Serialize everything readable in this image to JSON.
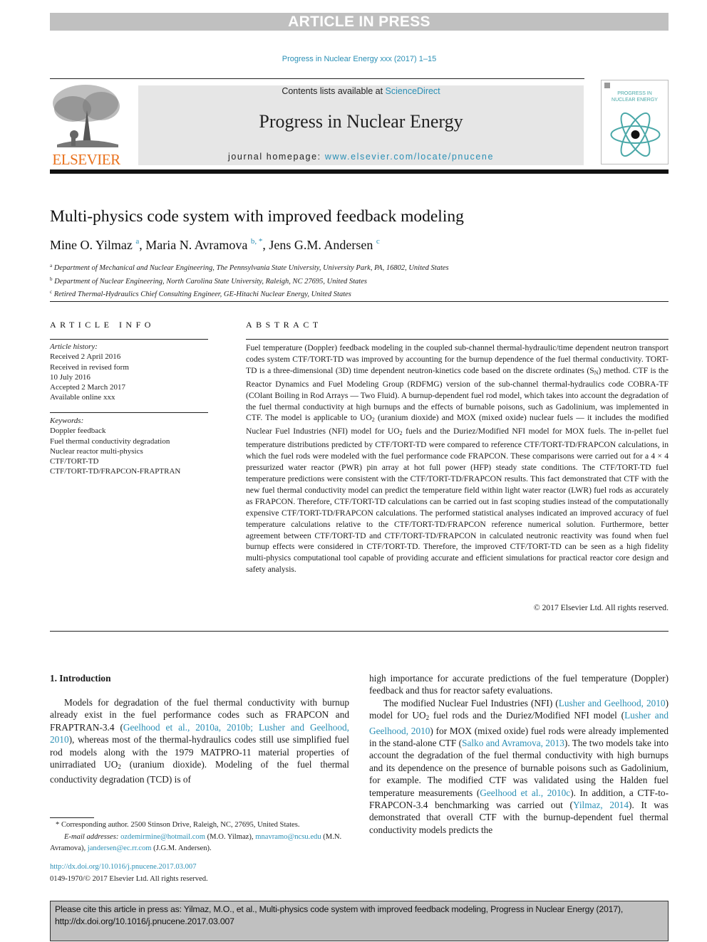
{
  "banner": {
    "text": "ARTICLE IN PRESS"
  },
  "journal_ref": "Progress in Nuclear Energy xxx (2017) 1–15",
  "masthead": {
    "publisher": "ELSEVIER",
    "contents_prefix": "Contents lists available at ",
    "contents_link": "ScienceDirect",
    "journal_title": "Progress in Nuclear Energy",
    "homepage_prefix": "journal homepage: ",
    "homepage_link": "www.elsevier.com/locate/pnucene",
    "cover_title_line1": "PROGRESS IN",
    "cover_title_line2": "NUCLEAR ENERGY"
  },
  "article": {
    "title": "Multi-physics code system with improved feedback modeling",
    "authors": [
      {
        "name": "Mine O. Yilmaz",
        "sup": "a"
      },
      {
        "name": "Maria N. Avramova",
        "sup": "b, *"
      },
      {
        "name": "Jens G.M. Andersen",
        "sup": "c"
      }
    ],
    "affiliations": [
      {
        "sup": "a",
        "text": "Department of Mechanical and Nuclear Engineering, The Pennsylvania State University, University Park, PA, 16802, United States"
      },
      {
        "sup": "b",
        "text": "Department of Nuclear Engineering, North Carolina State University, Raleigh, NC 27695, United States"
      },
      {
        "sup": "c",
        "text": "Retired Thermal-Hydraulics Chief Consulting Engineer, GE-Hitachi Nuclear Energy, United States"
      }
    ]
  },
  "article_info": {
    "heading": "ARTICLE INFO",
    "history_label": "Article history:",
    "history": [
      "Received 2 April 2016",
      "Received in revised form",
      "10 July 2016",
      "Accepted 2 March 2017",
      "Available online xxx"
    ],
    "keywords_label": "Keywords:",
    "keywords": [
      "Doppler feedback",
      "Fuel thermal conductivity degradation",
      "Nuclear reactor multi-physics",
      "CTF/TORT-TD",
      "CTF/TORT-TD/FRAPCON-FRAPTRAN"
    ]
  },
  "abstract": {
    "heading": "ABSTRACT",
    "p1": "Fuel temperature (Doppler) feedback modeling in the coupled sub-channel thermal-hydraulic/time dependent neutron transport codes system CTF/TORT-TD was improved by accounting for the burnup dependence of the fuel thermal conductivity. TORT-TD is a three-dimensional (3D) time dependent neutron-kinetics code based on the discrete ordinates (S",
    "sub_n": "N",
    "p2": ") method. CTF is the Reactor Dynamics and Fuel Modeling Group (RDFMG) version of the sub-channel thermal-hydraulics code COBRA-TF (COlant Boiling in Rod Arrays — Two Fluid). A burnup-dependent fuel rod model, which takes into account the degradation of the fuel thermal conductivity at high burnups and the effects of burnable poisons, such as Gadolinium, was implemented in CTF. The model is applicable to UO",
    "sub_2": "2",
    "p3": " (uranium dioxide) and MOX (mixed oxide) nuclear fuels — it includes the modified Nuclear Fuel Industries (NFI) model for UO",
    "p4": " fuels and the Duriez/Modified NFI model for MOX fuels. The in-pellet fuel temperature distributions predicted by CTF/TORT-TD were compared to reference CTF/TORT-TD/FRAPCON calculations, in which the fuel rods were modeled with the fuel performance code FRAPCON. These comparisons were carried out for a 4 × 4 pressurized water reactor (PWR) pin array at hot full power (HFP) steady state conditions. The CTF/TORT-TD fuel temperature predictions were consistent with the CTF/TORT-TD/FRAPCON results. This fact demonstrated that CTF with the new fuel thermal conductivity model can predict the temperature field within light water reactor (LWR) fuel rods as accurately as FRAPCON. Therefore, CTF/TORT-TD calculations can be carried out in fast scoping studies instead of the computationally expensive CTF/TORT-TD/FRAPCON calculations. The performed statistical analyses indicated an improved accuracy of fuel temperature calculations relative to the CTF/TORT-TD/FRAPCON reference numerical solution. Furthermore, better agreement between CTF/TORT-TD and CTF/TORT-TD/FRAPCON in calculated neutronic reactivity was found when fuel burnup effects were considered in CTF/TORT-TD. Therefore, the improved CTF/TORT-TD can be seen as a high fidelity multi-physics computational tool capable of providing accurate and efficient simulations for practical reactor core design and safety analysis.",
    "copyright": "© 2017 Elsevier Ltd. All rights reserved."
  },
  "intro": {
    "heading": "1.  Introduction",
    "left": {
      "t1": "Models for degradation of the fuel thermal conductivity with burnup already exist in the fuel performance codes such as FRAPCON and FRAPTRAN-3.4 (",
      "ref1": "Geelhood et al., 2010a, 2010b; Lusher and Geelhood, 2010",
      "t2": "), whereas most of the thermal-hydraulics codes still use simplified fuel rod models along with the 1979 MATPRO-11 material properties of unirradiated UO",
      "sub": "2",
      "t3": " (uranium dioxide). Modeling of the fuel thermal conductivity degradation (TCD) is of"
    },
    "right": {
      "t1": "high importance for accurate predictions of the fuel temperature (Doppler) feedback and thus for reactor safety evaluations.",
      "t2": "The modified Nuclear Fuel Industries (NFI) (",
      "ref1": "Lusher and Geelhood, 2010",
      "t3": ") model for UO",
      "sub": "2",
      "t4": " fuel rods and the Duriez/Modified NFI model (",
      "ref2": "Lusher and Geelhood, 2010",
      "t5": ") for MOX (mixed oxide) fuel rods were already implemented in the stand-alone CTF (",
      "ref3": "Salko and Avramova, 2013",
      "t6": "). The two models take into account the degradation of the fuel thermal conductivity with high burnups and its dependence on the presence of burnable poisons such as Gadolinium, for example. The modified CTF was validated using the Halden fuel temperature measurements (",
      "ref4": "Geelhood et al., 2010c",
      "t7": "). In addition, a CTF-to-FRAPCON-3.4 benchmarking was carried out (",
      "ref5": "Yilmaz, 2014",
      "t8": "). It was demonstrated that overall CTF with the burnup-dependent fuel thermal conductivity models predicts the"
    }
  },
  "footnote": {
    "star": "*",
    "corresponding": "Corresponding author. 2500 Stinson Drive, Raleigh, NC, 27695, United States.",
    "email_label": "E-mail addresses:",
    "emails": [
      {
        "addr": "ozdemirmine@hotmail.com",
        "who": " (M.O. Yilmaz), "
      },
      {
        "addr": "mnavramo@ncsu.edu",
        "who": " (M.N. Avramova), "
      },
      {
        "addr": "jandersen@ec.rr.com",
        "who": " (J.G.M. Andersen)."
      }
    ]
  },
  "doi": {
    "link": "http://dx.doi.org/10.1016/j.pnucene.2017.03.007",
    "issn": "0149-1970/© 2017 Elsevier Ltd. All rights reserved."
  },
  "cite_box": {
    "text": "Please cite this article in press as: Yilmaz, M.O., et al., Multi-physics code system with improved feedback modeling, Progress in Nuclear Energy (2017), http://dx.doi.org/10.1016/j.pnucene.2017.03.007"
  },
  "colors": {
    "link": "#2a8fb5",
    "elsevier_orange": "#e9711c",
    "banner_gray": "#c0c0c0",
    "masthead_gray": "#e6e6e6"
  }
}
